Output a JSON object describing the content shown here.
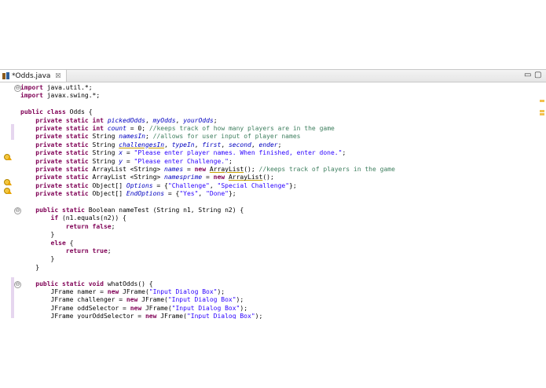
{
  "tab": {
    "title": "*Odds.java",
    "close": "☒"
  },
  "window_controls": {
    "minimize": "▭",
    "maximize": "▢"
  },
  "code_lines": [
    "import java.util.*;",
    "import javax.swing.*;",
    "",
    "public class Odds {",
    "    private static int pickedOdds, myOdds, yourOdds;",
    "    private static int count = 0; //keeps track of how many players are in the game",
    "    private static String namesIn; //allows for user input of player names",
    "    private static String challengesIn, typeIn, first, second, ender;",
    "    private static String x = \"Please enter player names. When finished, enter done.\";",
    "    private static String y = \"Please enter Challenge.\";",
    "    private static ArrayList <String> names = new ArrayList(); //keeps track of players in the game",
    "    private static ArrayList <String> namesprime = new ArrayList();",
    "    private static Object[] Options = {\"Challenge\", \"Special Challenge\"};",
    "    private static Object[] EndOptions = {\"Yes\", \"Done\"};",
    "",
    "    public static Boolean nameTest (String n1, String n2) {",
    "        if (n1.equals(n2)) {",
    "            return false;",
    "        }",
    "        else {",
    "            return true;",
    "        }",
    "    }",
    "",
    "    public static void whatOdds() {",
    "        JFrame namer = new JFrame(\"Input Dialog Box\");",
    "        JFrame challenger = new JFrame(\"Input Dialog Box\");",
    "        JFrame oddSelector = new JFrame(\"Input Dialog Box\");",
    "        JFrame yourOddSelector = new JFrame(\"Input Dialog Box\");"
  ],
  "fold_markers": [
    "⊖",
    "⊖",
    "⊖"
  ],
  "colors": {
    "keyword": "#7f0055",
    "string": "#2a00ff",
    "comment": "#3f7f5f",
    "field": "#0000c0"
  }
}
